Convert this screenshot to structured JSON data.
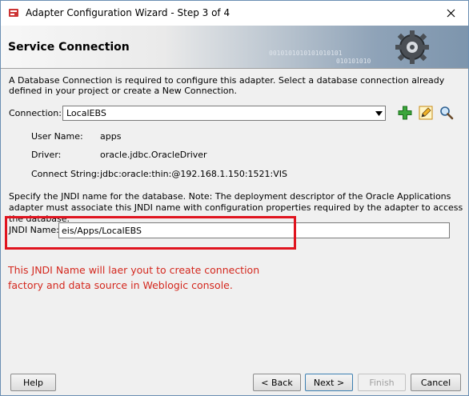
{
  "window": {
    "title": "Adapter Configuration Wizard - Step 3 of 4"
  },
  "banner": {
    "title": "Service Connection",
    "binary_text_1": "0010101010101010101",
    "binary_text_2": "010101010"
  },
  "description": "A Database Connection is required to configure this adapter. Select a database connection already defined in your project or create a New Connection.",
  "connection": {
    "label": "Connection:",
    "selected": "LocalEBS",
    "icons": [
      "add-icon",
      "edit-icon",
      "search-icon"
    ]
  },
  "details": [
    {
      "label": "User Name:",
      "value": "apps"
    },
    {
      "label": "Driver:",
      "value": "oracle.jdbc.OracleDriver"
    },
    {
      "label": "Connect String:",
      "value": "jdbc:oracle:thin:@192.168.1.150:1521:VIS"
    }
  ],
  "jndi": {
    "description": "Specify the JNDI name for the database.  Note: The deployment descriptor of the Oracle Applications adapter must associate this JNDI name with configuration properties required by the adapter to access the database.",
    "label": "JNDI Name:",
    "value": "eis/Apps/LocalEBS"
  },
  "annotation": {
    "line1": "This JNDI Name will laer yout to create connection",
    "line2": "factory and data source in Weblogic console.",
    "color": "#d4281e"
  },
  "buttons": {
    "help": "Help",
    "back": "< Back",
    "next": "Next >",
    "finish": "Finish",
    "cancel": "Cancel"
  }
}
